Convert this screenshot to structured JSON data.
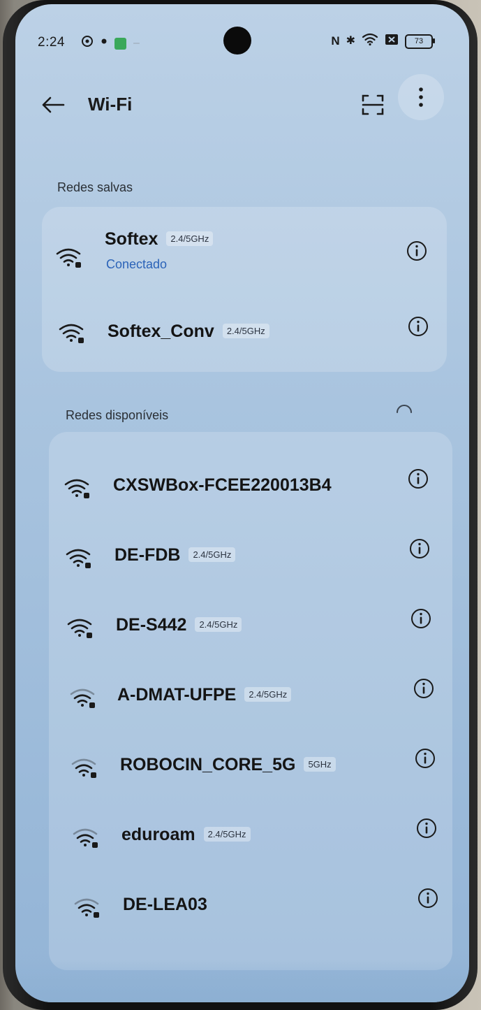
{
  "status_bar": {
    "time": "2:24",
    "left_icons": [
      "whatsapp-icon",
      "notification-dot-icon",
      "app-green-icon",
      "more-dash-icon"
    ],
    "nfc_label": "N",
    "bluetooth_label": "✱",
    "battery_level": "73"
  },
  "header": {
    "title": "Wi-Fi",
    "back_icon": "arrow-left-icon",
    "scan_icon": "qr-scan-icon",
    "more_icon": "more-vertical-icon"
  },
  "saved_section": {
    "label": "Redes salvas",
    "networks": [
      {
        "name": "Softex",
        "band": "2.4/5GHz",
        "status": "Conectado"
      },
      {
        "name": "Softex_Conv",
        "band": "2.4/5GHz",
        "status": ""
      }
    ]
  },
  "available_section": {
    "label": "Redes disponíveis",
    "networks": [
      {
        "name": "CXSWBox-FCEE220013B4",
        "band": ""
      },
      {
        "name": "DE-FDB",
        "band": "2.4/5GHz"
      },
      {
        "name": "DE-S442",
        "band": "2.4/5GHz"
      },
      {
        "name": "A-DMAT-UFPE",
        "band": "2.4/5GHz"
      },
      {
        "name": "ROBOCIN_CORE_5G",
        "band": "5GHz"
      },
      {
        "name": "eduroam",
        "band": "2.4/5GHz"
      },
      {
        "name": "DE-LEA03",
        "band": ""
      }
    ]
  },
  "colors": {
    "connected_status": "#2b63b8",
    "screen_top": "#bcd1e6",
    "screen_bottom": "#93b4d6"
  }
}
